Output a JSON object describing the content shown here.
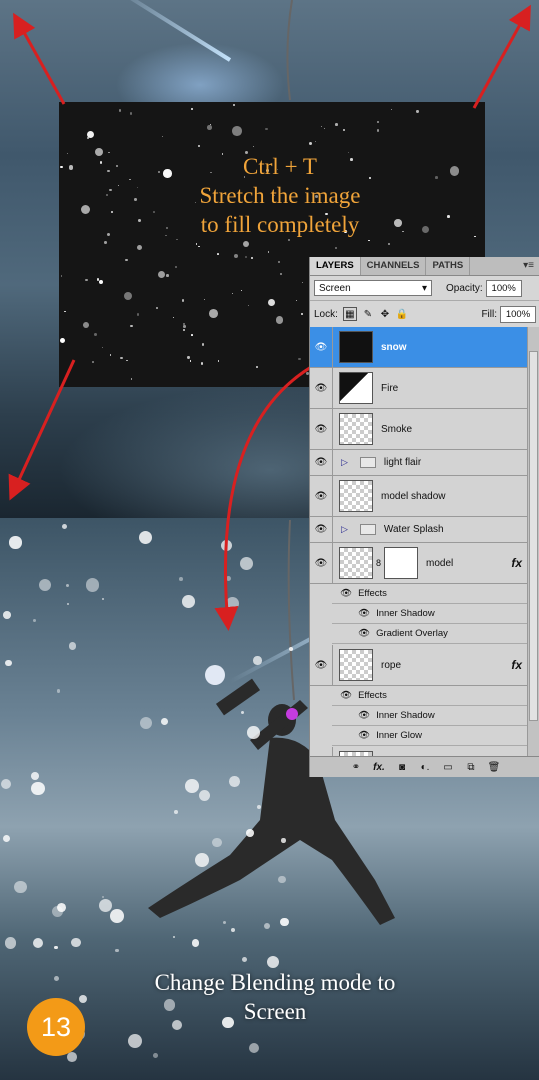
{
  "tutorial": {
    "caption_top_line1": "Ctrl + T",
    "caption_top_line2": "Stretch the image",
    "caption_top_line3": "to fill completely",
    "caption_bottom_line1": "Change Blending mode to",
    "caption_bottom_line2": "Screen",
    "step_number": "13"
  },
  "colors": {
    "caption_top": "#f0a43a",
    "caption_bottom": "#ffffff",
    "badge": "#f39a17",
    "arrow": "#d82020",
    "selection": "#3b8fe6"
  },
  "layers_panel": {
    "tabs": [
      "LAYERS",
      "CHANNELS",
      "PATHS"
    ],
    "menu_icon": "panel-menu-icon",
    "blend_mode": "Screen",
    "opacity_label": "Opacity:",
    "opacity_value": "100%",
    "lock_label": "Lock:",
    "fill_label": "Fill:",
    "fill_value": "100%",
    "layers": [
      {
        "name": "snow",
        "selected": true
      },
      {
        "name": "Fire"
      },
      {
        "name": "Smoke"
      },
      {
        "name": "light flair",
        "group": true
      },
      {
        "name": "model shadow"
      },
      {
        "name": "Water Splash",
        "group": true
      },
      {
        "name": "model",
        "fx": true,
        "effects_label": "Effects",
        "effects": [
          "Inner Shadow",
          "Gradient Overlay"
        ]
      },
      {
        "name": "rope",
        "fx": true,
        "effects_label": "Effects",
        "effects": [
          "Inner Shadow",
          "Inner Glow"
        ]
      }
    ],
    "fx_symbol": "fx",
    "bottom_icons": [
      "link-icon",
      "fx-icon",
      "mask-icon",
      "adjustment-icon",
      "folder-icon",
      "new-layer-icon",
      "trash-icon"
    ]
  }
}
